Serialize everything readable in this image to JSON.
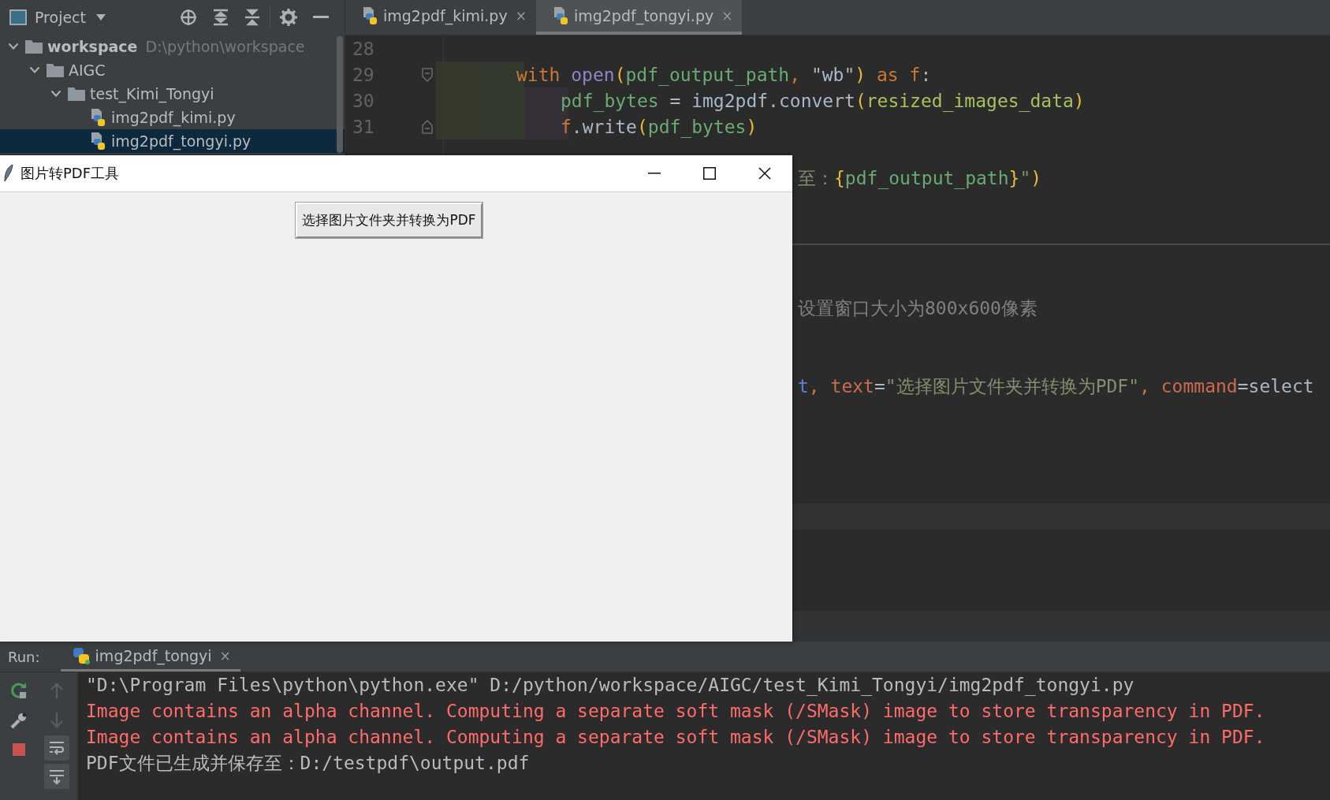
{
  "project_panel": {
    "title": "Project",
    "tree": [
      {
        "name": "workspace",
        "path": "D:\\python\\workspace",
        "kind": "folder",
        "expanded": true,
        "selected": false,
        "children": [
          {
            "name": "AIGC",
            "kind": "folder",
            "expanded": true,
            "selected": false,
            "children": [
              {
                "name": "test_Kimi_Tongyi",
                "kind": "folder",
                "expanded": true,
                "selected": false,
                "children": [
                  {
                    "name": "img2pdf_kimi.py",
                    "kind": "python",
                    "selected": false
                  },
                  {
                    "name": "img2pdf_tongyi.py",
                    "kind": "python",
                    "selected": true
                  }
                ]
              }
            ]
          }
        ]
      }
    ]
  },
  "editor_tabs": [
    {
      "label": "img2pdf_kimi.py",
      "close": "×",
      "selected": false
    },
    {
      "label": "img2pdf_tongyi.py",
      "close": "×",
      "selected": true
    }
  ],
  "editor": {
    "lines": [
      {
        "number": "28"
      },
      {
        "number": "29",
        "kind": "opener",
        "tokens": [
          {
            "kind": "keyword",
            "text": "with "
          },
          {
            "kind": "builtin",
            "text": "open"
          },
          {
            "kind": "bracket",
            "text": "("
          },
          {
            "kind": "var",
            "text": "pdf_output_path"
          },
          {
            "kind": "keyword",
            "text": ", "
          },
          {
            "kind": "plain",
            "text": "\"wb\""
          },
          {
            "kind": "bracket",
            "text": ")"
          },
          {
            "kind": "keyword",
            "text": " as "
          },
          {
            "kind": "keyword",
            "text": "f"
          },
          {
            "kind": "plain",
            "text": ":"
          }
        ],
        "children": [
          {
            "number": "30",
            "tokens": [
              {
                "kind": "var",
                "text": "pdf_bytes"
              },
              {
                "kind": "plain",
                "text": " = img2pdf.convert"
              },
              {
                "kind": "bracket",
                "text": "("
              },
              {
                "kind": "var2",
                "text": "resized_images_data"
              },
              {
                "kind": "bracket",
                "text": ")"
              }
            ]
          },
          {
            "number": "31",
            "kind": "closer",
            "tokens": [
              {
                "kind": "keyword",
                "text": "f"
              },
              {
                "kind": "plain",
                "text": ".write"
              },
              {
                "kind": "bracket",
                "text": "("
              },
              {
                "kind": "var",
                "text": "pdf_bytes"
              },
              {
                "kind": "bracket",
                "text": ")"
              }
            ]
          }
        ]
      }
    ],
    "partial_lines": [
      {
        "tokens": [
          {
            "kind": "string",
            "text": "至："
          },
          {
            "kind": "bracket",
            "text": "{"
          },
          {
            "kind": "var",
            "text": "pdf_output_path"
          },
          {
            "kind": "bracket",
            "text": "}"
          },
          {
            "kind": "string",
            "text": "\""
          },
          {
            "kind": "bracket",
            "text": ")"
          }
        ]
      },
      {
        "tokens": [
          {
            "kind": "comment",
            "text": "设置窗口大小为800x600像素"
          }
        ]
      },
      {
        "tokens": [
          {
            "kind": "ref",
            "text": "t"
          },
          {
            "kind": "keyword",
            "text": ", "
          },
          {
            "kind": "argname",
            "text": "text"
          },
          {
            "kind": "plain",
            "text": "="
          },
          {
            "kind": "string",
            "text": "\"选择图片文件夹并转换为PDF\""
          },
          {
            "kind": "keyword",
            "text": ", "
          },
          {
            "kind": "argname",
            "text": "command"
          },
          {
            "kind": "plain",
            "text": "=select"
          }
        ]
      }
    ]
  },
  "tk_window": {
    "title": "图片转PDF工具",
    "button": "选择图片文件夹并转换为PDF"
  },
  "run_panel": {
    "label": "Run:",
    "tabs": [
      {
        "label": "img2pdf_tongyi",
        "close": "×",
        "selected": true
      }
    ],
    "console": [
      {
        "kind": "command",
        "text": "\"D:\\Program Files\\python\\python.exe\" D:/python/workspace/AIGC/test_Kimi_Tongyi/img2pdf_tongyi.py"
      },
      {
        "kind": "error",
        "text": "Image contains an alpha channel. Computing a separate soft mask (/SMask) image to store transparency in PDF."
      },
      {
        "kind": "error",
        "text": "Image contains an alpha channel. Computing a separate soft mask (/SMask) image to store transparency in PDF."
      },
      {
        "kind": "output",
        "text": "PDF文件已生成并保存至：D:/testpdf\\output.pdf"
      }
    ]
  }
}
